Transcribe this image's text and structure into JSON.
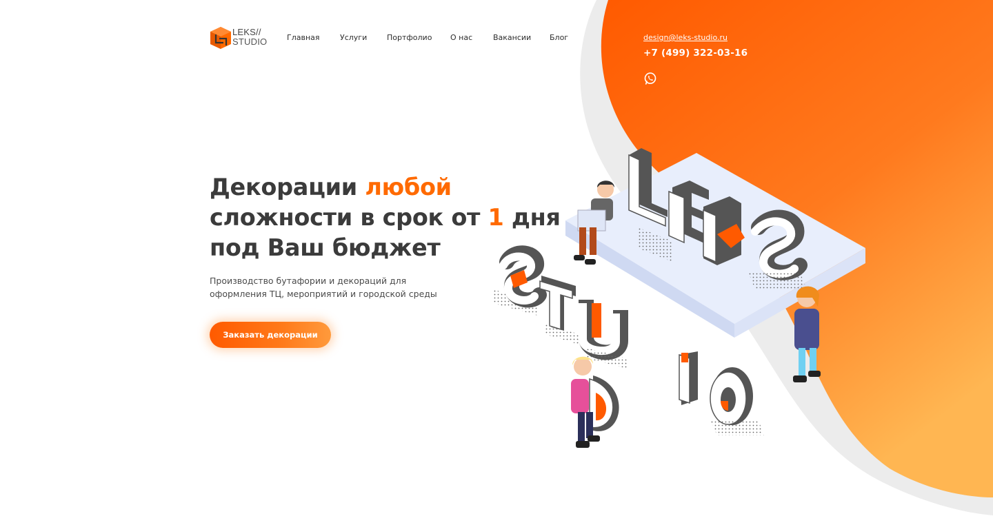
{
  "logo": {
    "line1": "LEKS//",
    "line2": "STUDIO"
  },
  "nav": {
    "items": [
      {
        "label": "Главная"
      },
      {
        "label": "Услуги"
      },
      {
        "label": "Портфолио"
      },
      {
        "label": "О нас"
      },
      {
        "label": "Вакансии"
      },
      {
        "label": "Блог"
      }
    ]
  },
  "contacts": {
    "email": "design@leks-studio.ru",
    "phone": "+7 (499) 322-03-16",
    "messenger_icon": "whatsapp-icon"
  },
  "hero": {
    "headline_p1": "Декорации ",
    "headline_accent1": "любой",
    "headline_p2": "сложности в срок от ",
    "headline_accent2": "1",
    "headline_p3": " дня",
    "headline_p4": "под Ваш бюджет",
    "subtitle": "Производство бутафории и декораций для оформления ТЦ, мероприятий и городской среды",
    "cta_label": "Заказать декорации"
  },
  "illustration": {
    "letters": [
      "L",
      "E",
      "K",
      "S",
      "S",
      "T",
      "U",
      "D",
      "I",
      "O"
    ]
  },
  "colors": {
    "accent": "#ff6a00",
    "accent_light": "#ffb04d",
    "text": "#3b3b3b",
    "gray_bg": "#ececec"
  }
}
